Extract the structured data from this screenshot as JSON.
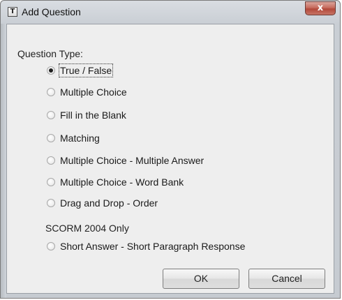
{
  "window": {
    "title": "Add Question",
    "icon": "question-doc-icon",
    "close_glyph": "x"
  },
  "question_type": {
    "label": "Question Type:",
    "options": [
      {
        "label": "True / False",
        "selected": true
      },
      {
        "label": "Multiple Choice",
        "selected": false
      },
      {
        "label": "Fill in the Blank",
        "selected": false
      },
      {
        "label": "Matching",
        "selected": false
      },
      {
        "label": "Multiple Choice - Multiple Answer",
        "selected": false
      },
      {
        "label": "Multiple Choice - Word Bank",
        "selected": false
      },
      {
        "label": "Drag and Drop - Order",
        "selected": false
      }
    ]
  },
  "scorm": {
    "label": "SCORM 2004 Only",
    "options": [
      {
        "label": "Short Answer - Short Paragraph Response",
        "selected": false
      }
    ]
  },
  "buttons": {
    "ok_label": "OK",
    "cancel_label": "Cancel"
  }
}
